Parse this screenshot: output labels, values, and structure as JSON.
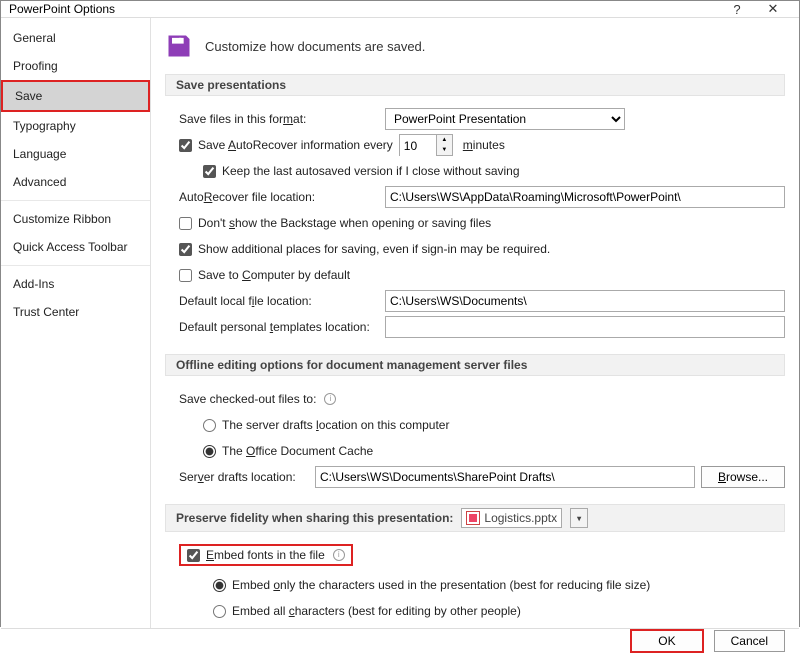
{
  "window": {
    "title": "PowerPoint Options"
  },
  "sidebar": {
    "items": [
      "General",
      "Proofing",
      "Save",
      "Typography",
      "Language",
      "Advanced",
      "Customize Ribbon",
      "Quick Access Toolbar",
      "Add-Ins",
      "Trust Center"
    ]
  },
  "header": "Customize how documents are saved.",
  "sec1": {
    "title": "Save presentations",
    "format_label": "Save files in this format:",
    "format_value": "PowerPoint Presentation",
    "autorecover_label": "Save AutoRecover information every",
    "autorecover_value": "10",
    "autorecover_unit": "minutes",
    "keep_last": "Keep the last autosaved version if I close without saving",
    "autorecover_loc_label": "AutoRecover file location:",
    "autorecover_loc_value": "C:\\Users\\WS\\AppData\\Roaming\\Microsoft\\PowerPoint\\",
    "dont_show": "Don't show the Backstage when opening or saving files",
    "show_additional": "Show additional places for saving, even if sign-in may be required.",
    "save_to_computer": "Save to Computer by default",
    "default_local_label": "Default local file location:",
    "default_local_value": "C:\\Users\\WS\\Documents\\",
    "default_templates_label": "Default personal templates location:",
    "default_templates_value": ""
  },
  "sec2": {
    "title": "Offline editing options for document management server files",
    "save_checked_label": "Save checked-out files to:",
    "radio1": "The server drafts location on this computer",
    "radio2": "The Office Document Cache",
    "server_drafts_label": "Server drafts location:",
    "server_drafts_value": "C:\\Users\\WS\\Documents\\SharePoint Drafts\\",
    "browse": "Browse..."
  },
  "sec3": {
    "title": "Preserve fidelity when sharing this presentation:",
    "file": "Logistics.pptx",
    "embed": "Embed fonts in the file",
    "embed_only": "Embed only the characters used in the presentation (best for reducing file size)",
    "embed_all": "Embed all characters (best for editing by other people)"
  },
  "buttons": {
    "ok": "OK",
    "cancel": "Cancel"
  }
}
